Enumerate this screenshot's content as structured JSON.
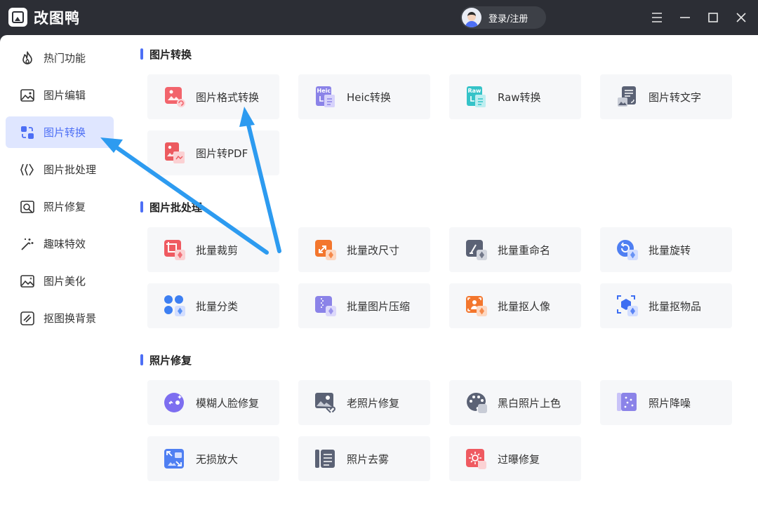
{
  "app": {
    "name": "改图鸭",
    "login_label": "登录/注册"
  },
  "sidebar": {
    "items": [
      {
        "label": "热门功能",
        "icon": "fire-icon"
      },
      {
        "label": "图片编辑",
        "icon": "image-edit-icon"
      },
      {
        "label": "图片转换",
        "icon": "convert-icon",
        "active": true
      },
      {
        "label": "图片批处理",
        "icon": "batch-icon"
      },
      {
        "label": "照片修复",
        "icon": "repair-icon"
      },
      {
        "label": "趣味特效",
        "icon": "magic-wand-icon"
      },
      {
        "label": "图片美化",
        "icon": "beautify-icon"
      },
      {
        "label": "抠图换背景",
        "icon": "cutout-icon"
      }
    ]
  },
  "sections": [
    {
      "title": "图片转换",
      "cards": [
        {
          "label": "图片格式转换",
          "icon": "format-convert-icon"
        },
        {
          "label": "Heic转换",
          "icon": "heic-icon",
          "icon_text": "Heic"
        },
        {
          "label": "Raw转换",
          "icon": "raw-icon",
          "icon_text": "Raw"
        },
        {
          "label": "图片转文字",
          "icon": "image-to-text-icon"
        },
        {
          "label": "图片转PDF",
          "icon": "image-to-pdf-icon"
        }
      ]
    },
    {
      "title": "图片批处理",
      "cards": [
        {
          "label": "批量裁剪",
          "icon": "batch-crop-icon"
        },
        {
          "label": "批量改尺寸",
          "icon": "batch-resize-icon"
        },
        {
          "label": "批量重命名",
          "icon": "batch-rename-icon"
        },
        {
          "label": "批量旋转",
          "icon": "batch-rotate-icon"
        },
        {
          "label": "批量分类",
          "icon": "batch-classify-icon"
        },
        {
          "label": "批量图片压缩",
          "icon": "batch-compress-icon"
        },
        {
          "label": "批量抠人像",
          "icon": "batch-portrait-cutout-icon"
        },
        {
          "label": "批量抠物品",
          "icon": "batch-object-cutout-icon"
        }
      ]
    },
    {
      "title": "照片修复",
      "cards": [
        {
          "label": "模糊人脸修复",
          "icon": "face-repair-icon"
        },
        {
          "label": "老照片修复",
          "icon": "old-photo-repair-icon"
        },
        {
          "label": "黑白照片上色",
          "icon": "colorize-icon"
        },
        {
          "label": "照片降噪",
          "icon": "denoise-icon"
        },
        {
          "label": "无损放大",
          "icon": "upscale-icon"
        },
        {
          "label": "照片去雾",
          "icon": "dehaze-icon"
        },
        {
          "label": "过曝修复",
          "icon": "overexposure-fix-icon"
        }
      ]
    }
  ],
  "colors": {
    "accent": "#4d6ff5",
    "titlebar": "#2c2e35",
    "card_bg": "#f6f7f9",
    "active_bg": "#dfe6ff",
    "arrow": "#2d9bf0"
  }
}
